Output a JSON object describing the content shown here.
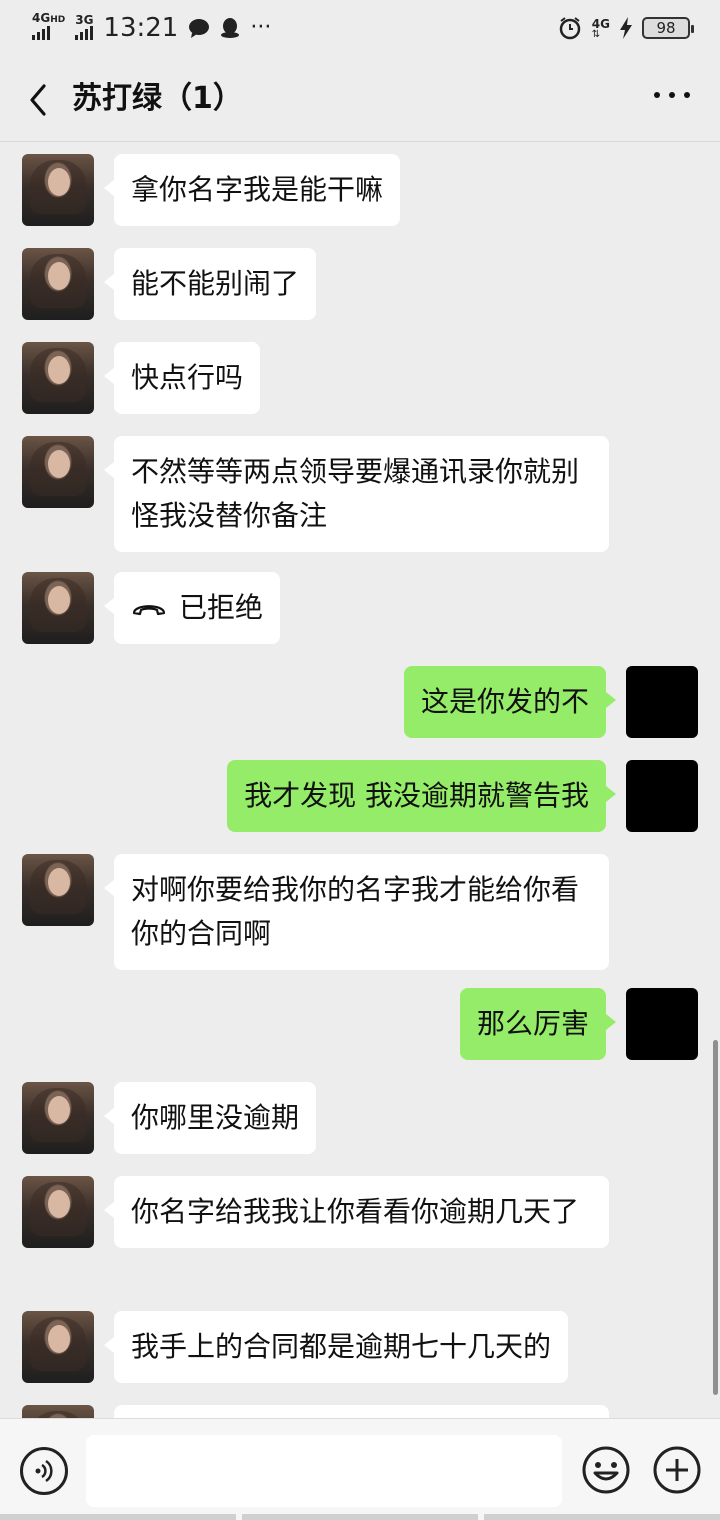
{
  "status_bar": {
    "network_1": "4G",
    "network_1_sup": "HD",
    "network_2": "3G",
    "time": "13:21",
    "icons_left": [
      "chat-bubble-icon",
      "qq-icon",
      "more-dots-icon"
    ],
    "icons_right": [
      "alarm-icon",
      "4g-data-icon",
      "charging-icon"
    ],
    "network_right": "4G",
    "battery": "98"
  },
  "header": {
    "title": "苏打绿（1）",
    "back_icon": "chevron-left-icon",
    "more_icon": "more-horizontal-icon"
  },
  "messages": [
    {
      "from": "them",
      "text": "拿你名字我是能干嘛"
    },
    {
      "from": "them",
      "text": "能不能别闹了"
    },
    {
      "from": "them",
      "text": "快点行吗"
    },
    {
      "from": "them",
      "text": "不然等等两点领导要爆通讯录你就别怪我没替你备注"
    },
    {
      "from": "them",
      "type": "call",
      "text": "已拒绝",
      "icon": "hangup-phone-icon"
    },
    {
      "from": "me",
      "text": "这是你发的不"
    },
    {
      "from": "me",
      "text": "我才发现 我没逾期就警告我"
    },
    {
      "from": "them",
      "text": "对啊你要给我你的名字我才能给你看你的合同啊"
    },
    {
      "from": "me",
      "text": "那么厉害"
    },
    {
      "from": "them",
      "text": "你哪里没逾期"
    },
    {
      "from": "them",
      "text": "你名字给我我让你看看你逾期几天了"
    },
    {
      "from": "them",
      "text": "我手上的合同都是逾期七十几天的"
    }
  ],
  "input_bar": {
    "voice_icon": "voice-input-icon",
    "input_value": "",
    "emoji_icon": "emoji-icon",
    "plus_icon": "plus-icon"
  },
  "colors": {
    "background": "#ededed",
    "incoming_bubble": "#ffffff",
    "outgoing_bubble": "#95ec69"
  }
}
